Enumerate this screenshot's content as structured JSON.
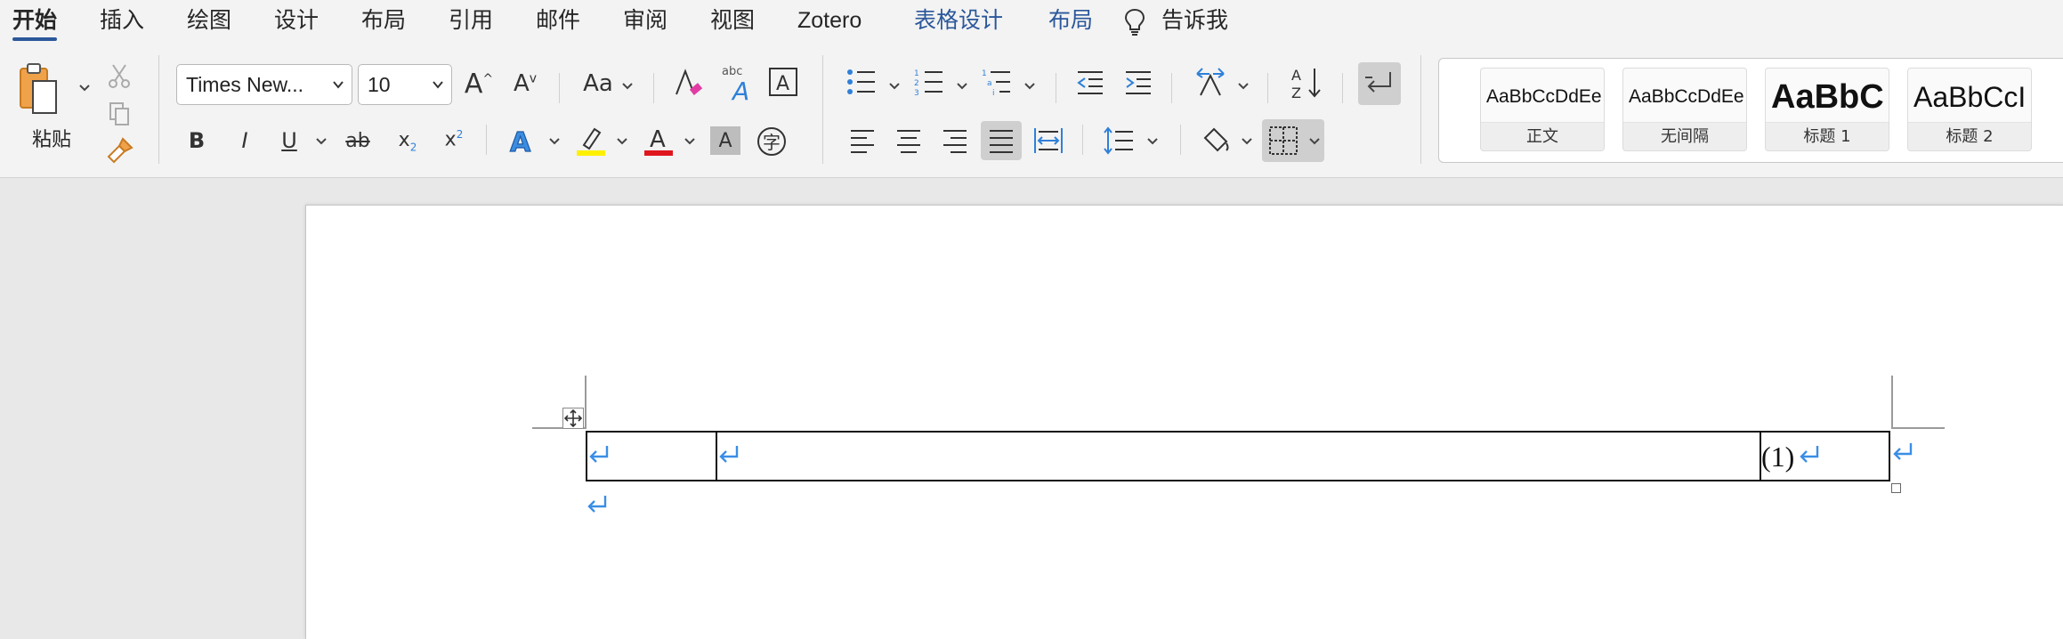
{
  "tabs": [
    "开始",
    "插入",
    "绘图",
    "设计",
    "布局",
    "引用",
    "邮件",
    "审阅",
    "视图",
    "Zotero",
    "表格设计",
    "布局",
    "告诉我"
  ],
  "active_tab": "开始",
  "colors": {
    "accent": "#2b579a",
    "highlight_bar": "#ffef00",
    "font_color_bar": "#e0161e",
    "pilcrow": "#3a8ee6"
  },
  "clipboard": {
    "paste_label": "粘贴"
  },
  "font": {
    "family": "Times New...",
    "size": "10"
  },
  "styles": [
    {
      "sample": "AaBbCcDdEe",
      "name": "正文"
    },
    {
      "sample": "AaBbCcDdEe",
      "name": "无间隔"
    },
    {
      "sample": "AaBbC",
      "name": "标题 1"
    },
    {
      "sample": "AaBbCcI",
      "name": "标题 2"
    }
  ],
  "document": {
    "equation_number": "(1)"
  }
}
